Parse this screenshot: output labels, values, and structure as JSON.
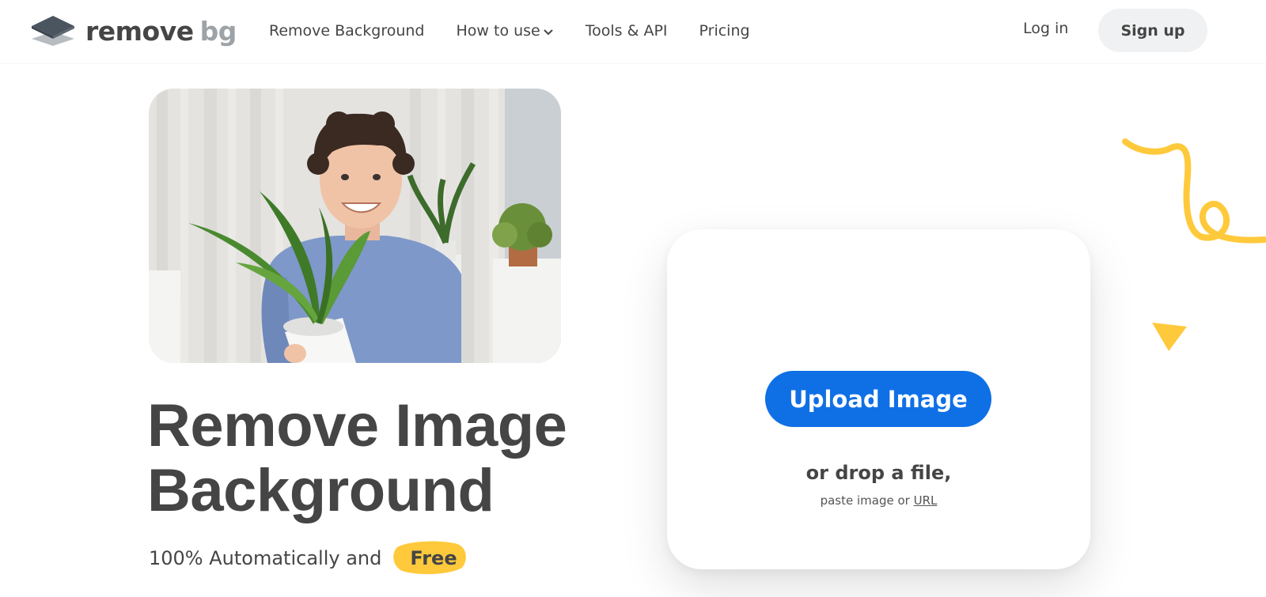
{
  "header": {
    "logo": {
      "word1": "remove",
      "word2": "bg"
    },
    "nav": [
      {
        "label": "Remove Background"
      },
      {
        "label": "How to use"
      },
      {
        "label": "Tools & API"
      },
      {
        "label": "Pricing"
      }
    ],
    "login_label": "Log in",
    "signup_label": "Sign up"
  },
  "hero": {
    "title_line1": "Remove Image",
    "title_line2": "Background",
    "subtitle": "100% Automatically and",
    "free_label": "Free"
  },
  "upload": {
    "button_label": "Upload Image",
    "drop_text": "or drop a file,",
    "paste_text": "paste image or",
    "url_label": "URL"
  },
  "colors": {
    "accent_blue": "#0f70e6",
    "accent_yellow": "#ffc93c",
    "text": "#454545",
    "logo_grey": "#9ea3a8"
  },
  "icons": [
    "logo-layers-icon",
    "chevron-down-icon",
    "squiggle-decoration",
    "triangle-decoration"
  ]
}
